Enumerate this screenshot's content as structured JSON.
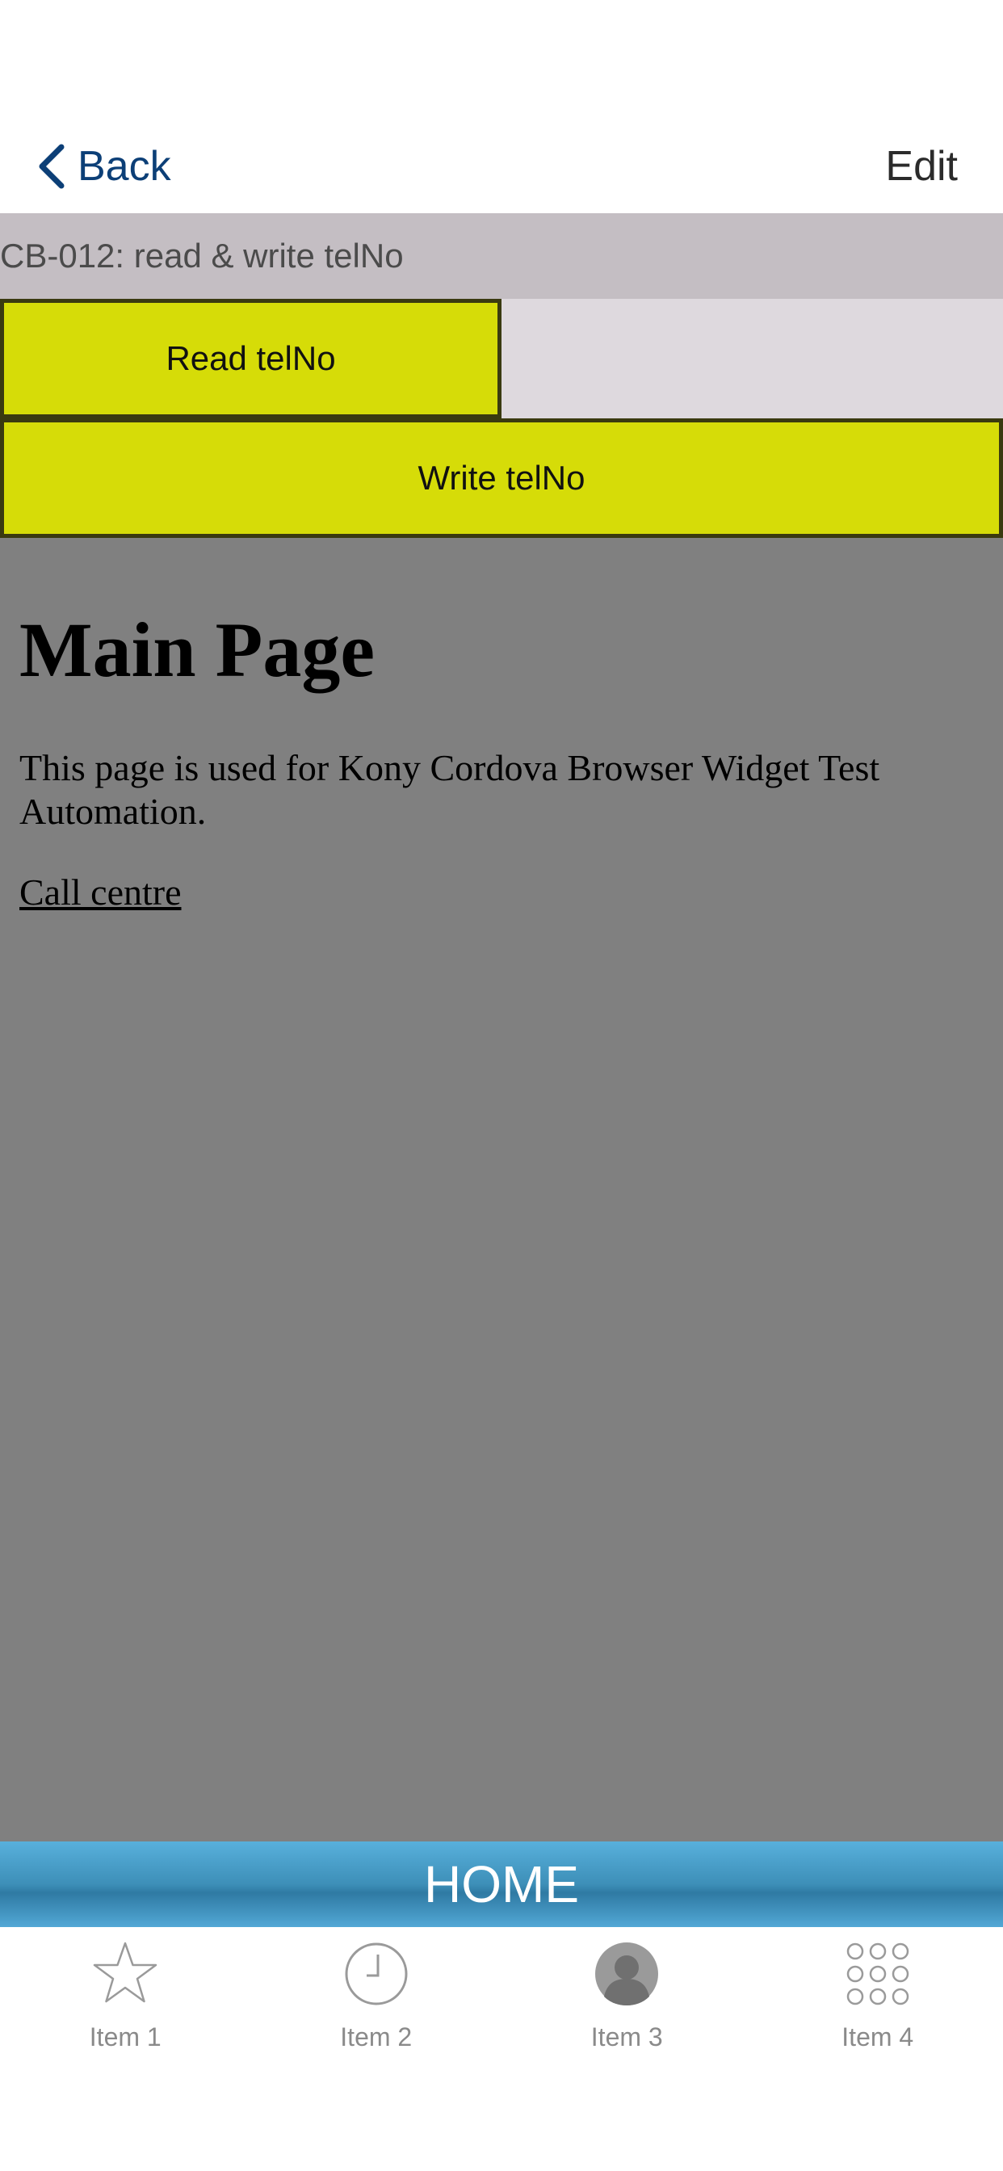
{
  "navbar": {
    "back_label": "Back",
    "edit_label": "Edit"
  },
  "form": {
    "title": "CB-012: read & write telNo",
    "read_button": "Read telNo",
    "write_button": "Write telNo"
  },
  "browser": {
    "heading": "Main Page",
    "description": "This page is used for Kony Cordova Browser Widget Test Automation.",
    "link": "Call centre"
  },
  "home_bar": {
    "label": "HOME"
  },
  "tabs": [
    {
      "label": "Item 1",
      "icon": "star-icon"
    },
    {
      "label": "Item 2",
      "icon": "clock-icon"
    },
    {
      "label": "Item 3",
      "icon": "person-icon"
    },
    {
      "label": "Item 4",
      "icon": "grid-icon"
    }
  ],
  "colors": {
    "nav_back": "#0c3f77",
    "title_bar": "#c4bec3",
    "button_yellow": "#d6dc08",
    "browser_bg": "#808080",
    "home_bar": "#3d8fb8"
  }
}
